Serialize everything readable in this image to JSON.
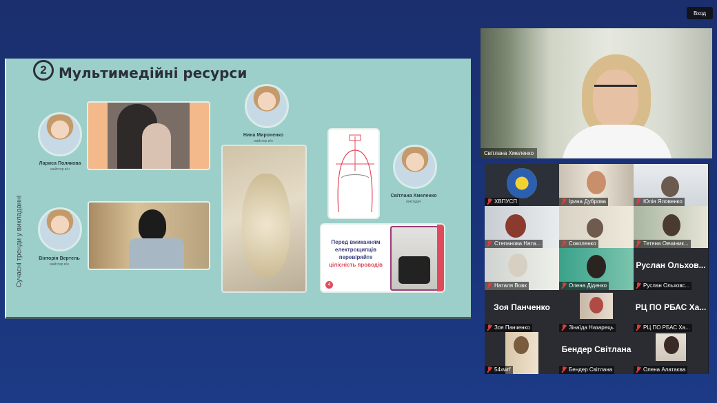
{
  "topbar": {
    "login_label": "Вход"
  },
  "slide": {
    "number": "2",
    "title": "Мультимедійні ресурси",
    "vertical_text": "Сучасні тренди у викладанні",
    "people": [
      {
        "name": "Лариса Полякова",
        "role": "майстер в/н"
      },
      {
        "name": "Вікторія Вертель",
        "role": "майстер в/н"
      },
      {
        "name": "Нина Мироненко",
        "role": "майстер в/н"
      },
      {
        "name": "Світлана Хмеленко",
        "role": "викладач"
      }
    ],
    "card": {
      "line1": "Перед вмиканням електрощипців перевіряйте",
      "line2": "цілісність проводів",
      "badge": "4"
    }
  },
  "speaker": {
    "name": "Світлана Хмеленко"
  },
  "participants": [
    {
      "name": "ХВПУСП",
      "type": "logo"
    },
    {
      "name": "Ірина Дуброва",
      "type": "video"
    },
    {
      "name": "Юлія Яловенко",
      "type": "video"
    },
    {
      "name": "Степанова Ната...",
      "type": "video"
    },
    {
      "name": "Соколенко",
      "type": "video"
    },
    {
      "name": "Тетяна Овчиник...",
      "type": "video"
    },
    {
      "name": "Наталя Вовк",
      "type": "video"
    },
    {
      "name": "Олена Діденко",
      "type": "video"
    },
    {
      "name": "Руслан Ольховс...",
      "type": "text",
      "display": "Руслан Ольхов..."
    },
    {
      "name": "Зоя Панченко",
      "type": "text",
      "display": "Зоя Панченко"
    },
    {
      "name": "Зінаїда Назарець",
      "type": "video"
    },
    {
      "name": "РЦ ПО РБАС Ха...",
      "type": "text",
      "display": "РЦ ПО РБАС Ха..."
    },
    {
      "name": "54xwrf",
      "type": "video"
    },
    {
      "name": "Бендер Світлана",
      "type": "text",
      "display": "Бендер Світлана"
    },
    {
      "name": "Олена Алатаєва",
      "type": "video"
    }
  ],
  "colors": {
    "background": "#1a3378",
    "slide": "#9ccfc9",
    "accent": "#e04b5c"
  }
}
